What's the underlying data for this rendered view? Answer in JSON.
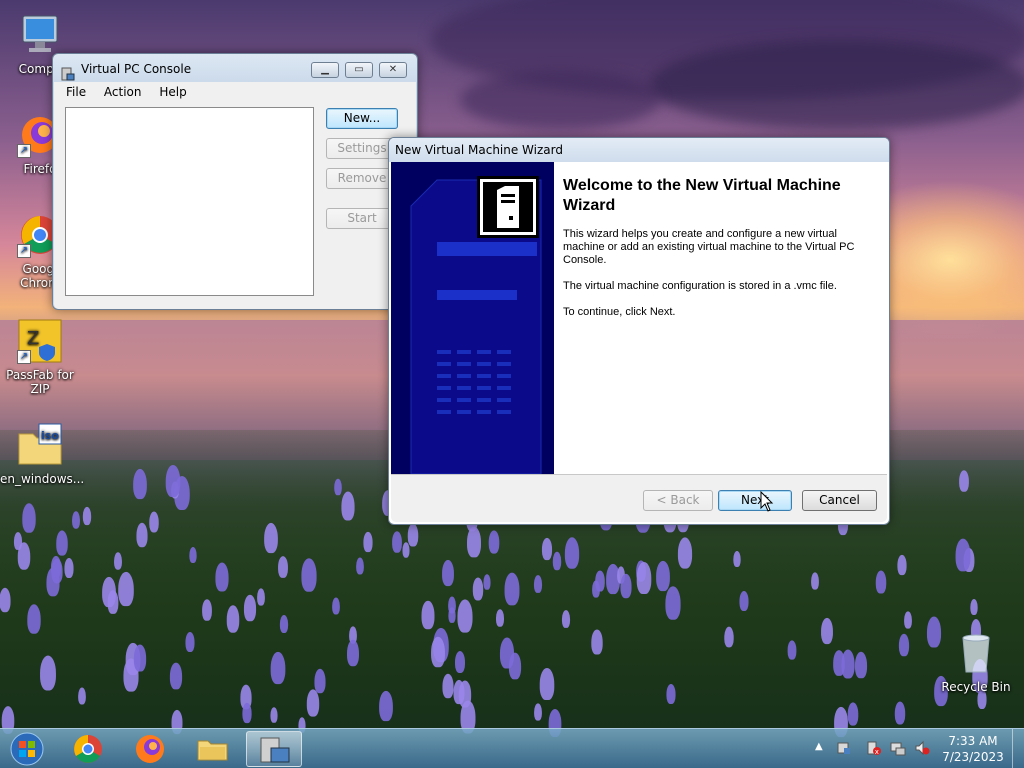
{
  "desktop": {
    "icons": [
      {
        "label": "Compu",
        "icon": "computer-icon"
      },
      {
        "label": "Firefo",
        "icon": "firefox-icon"
      },
      {
        "label": "Googl\nChrom",
        "icon": "chrome-icon"
      },
      {
        "label": "PassFab for ZIP",
        "icon": "passfab-zip-icon"
      },
      {
        "label": "en_windows...",
        "icon": "iso-folder-icon"
      },
      {
        "label": "Recycle Bin",
        "icon": "recycle-bin-icon"
      }
    ]
  },
  "console": {
    "title": "Virtual PC Console",
    "menu": [
      "File",
      "Action",
      "Help"
    ],
    "buttons": {
      "new": "New...",
      "settings": "Settings",
      "remove": "Remove",
      "start": "Start"
    }
  },
  "wizard": {
    "title": "New Virtual Machine Wizard",
    "heading": "Welcome to the New Virtual Machine Wizard",
    "paragraphs": [
      "This wizard helps you create and configure a new virtual machine or add an existing virtual machine to the Virtual PC Console.",
      "The virtual machine configuration is stored in a .vmc file.",
      "To continue, click Next."
    ],
    "buttons": {
      "back": "< Back",
      "next": "Next",
      "cancel": "Cancel"
    }
  },
  "taskbar": {
    "pinned": [
      "start-orb-icon",
      "chrome-icon",
      "firefox-icon",
      "file-explorer-icon",
      "virtual-pc-icon"
    ],
    "time": "7:33 AM",
    "date": "7/23/2023"
  }
}
